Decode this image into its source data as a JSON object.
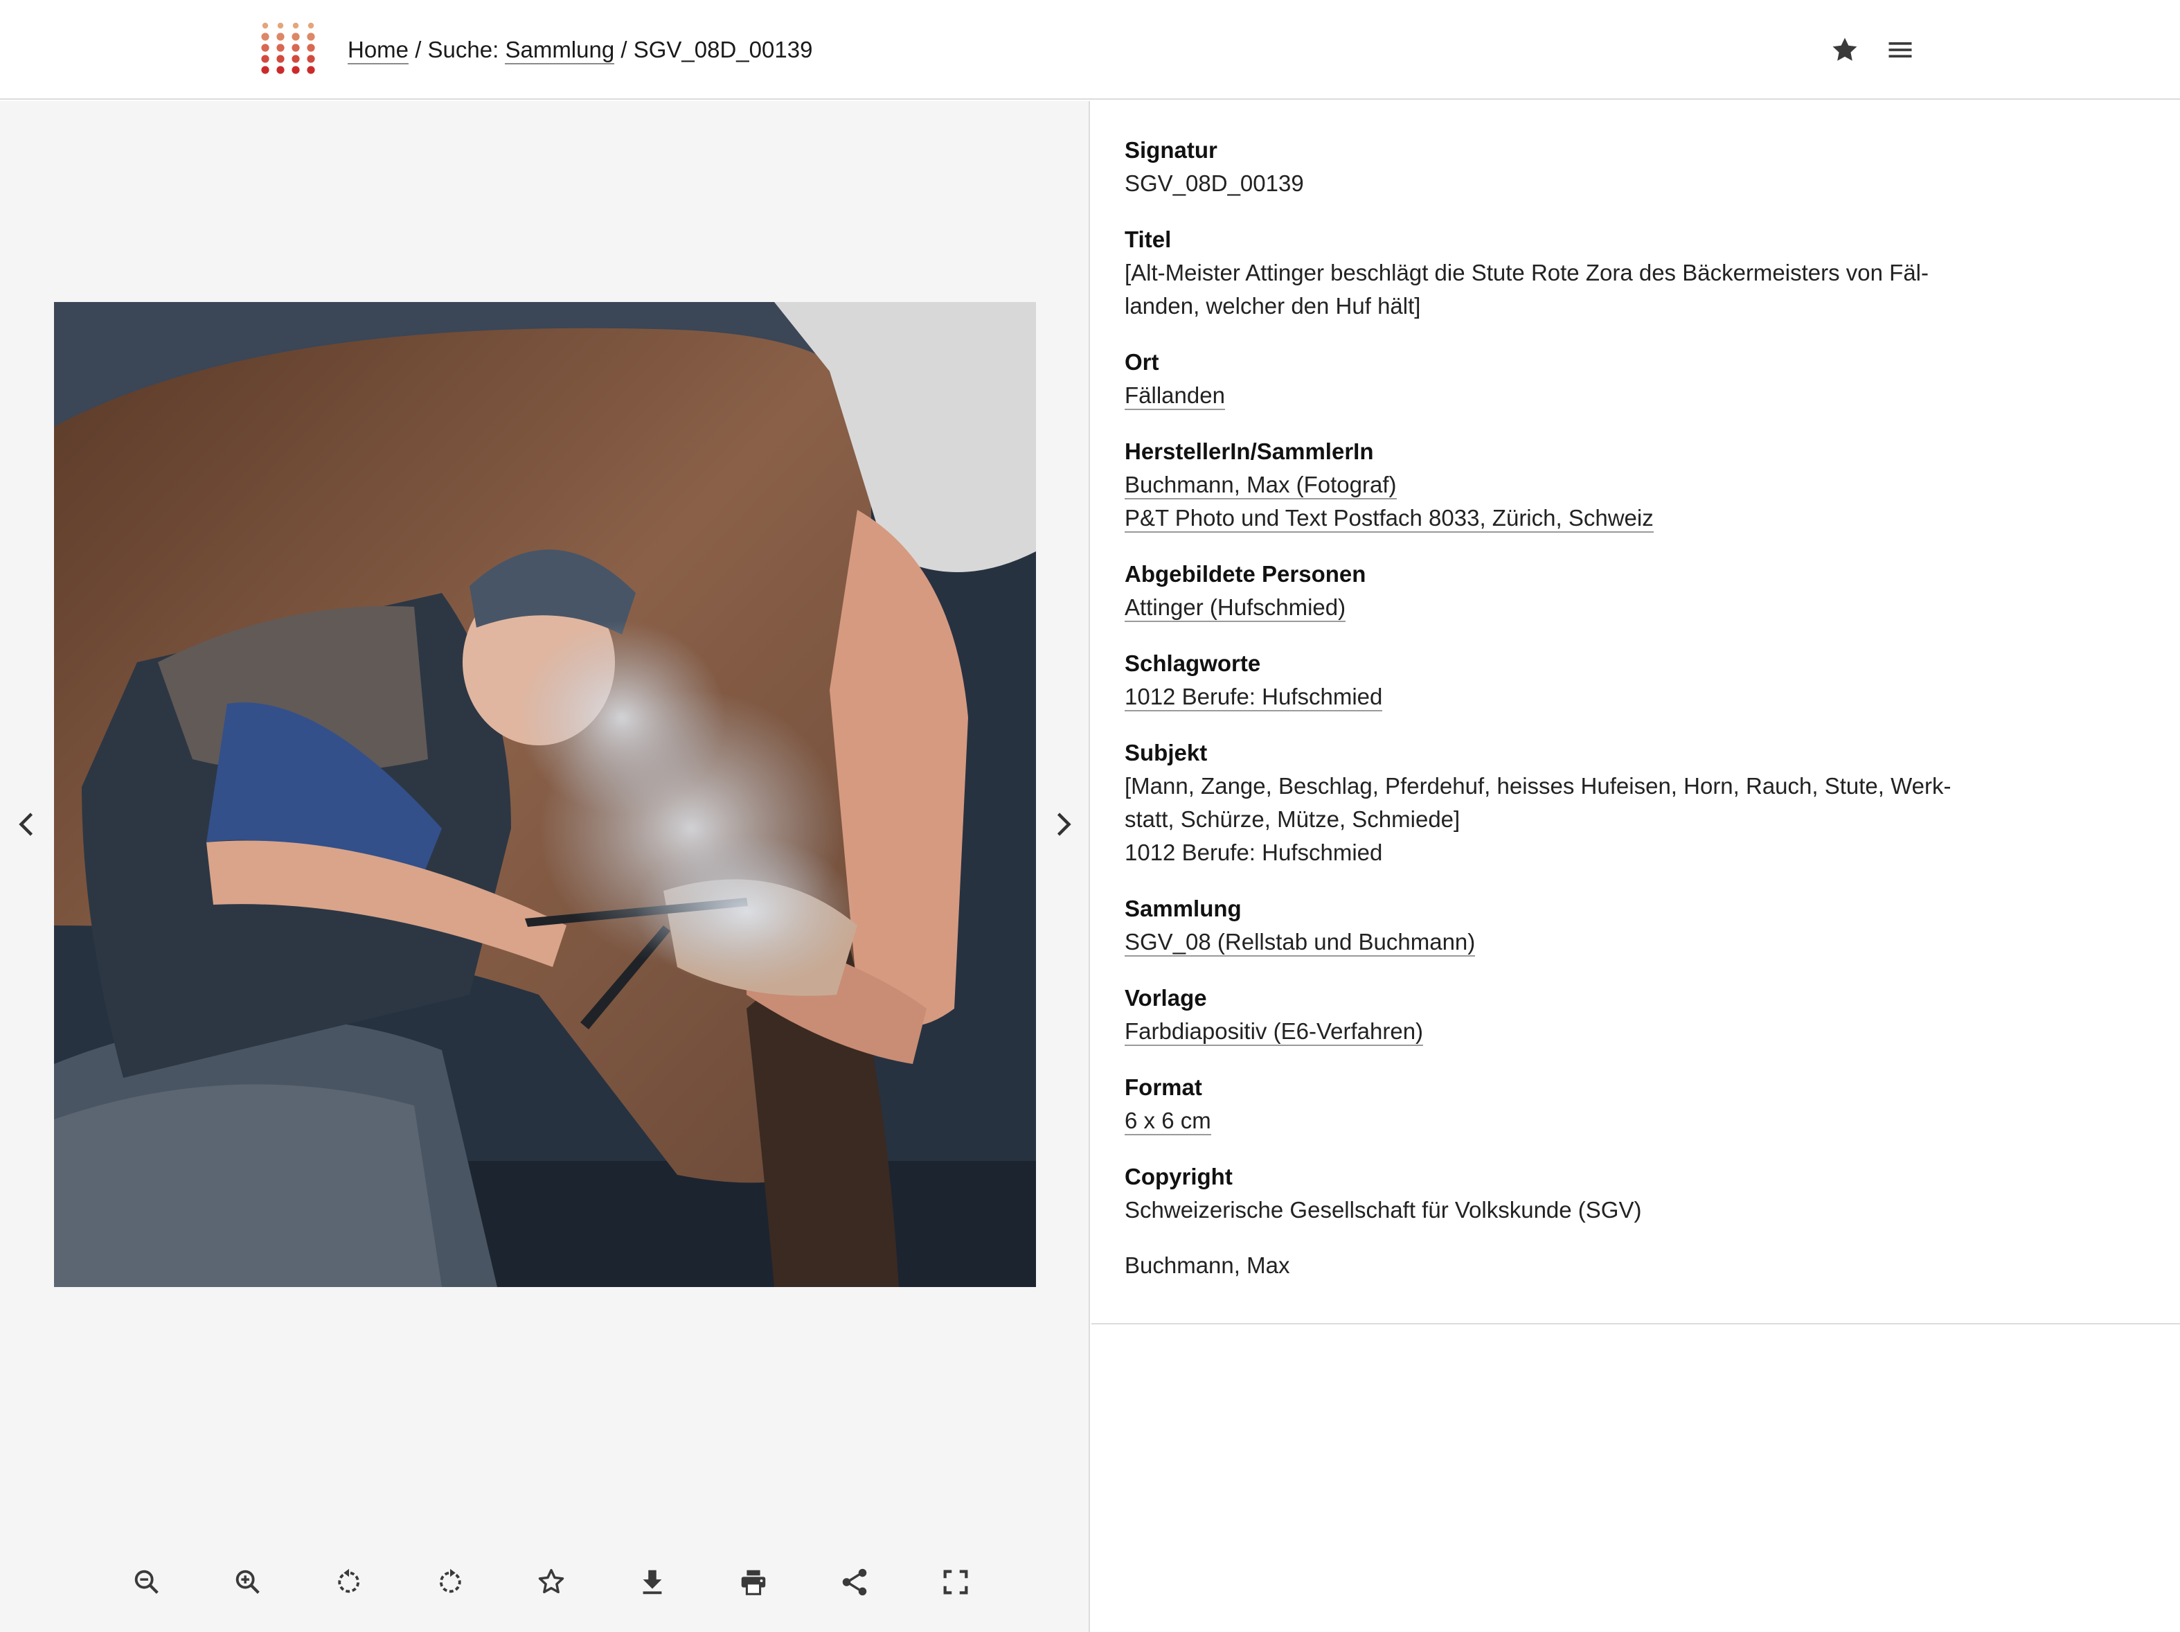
{
  "header": {
    "breadcrumb": {
      "home": "Home",
      "sep1": " / ",
      "search_prefix": "Suche: ",
      "search_link": "Sammlung",
      "sep2": " / ",
      "current": "SGV_08D_00139"
    },
    "icons": [
      "logo-dots",
      "star-icon",
      "menu-icon"
    ]
  },
  "colors": {
    "logo_top": "#e3a67a",
    "logo_bottom": "#cc2a2a",
    "viewer_bg": "#f5f5f6",
    "text": "#1a1a1a"
  },
  "viewer": {
    "prev_icon": "chevron-left-icon",
    "next_icon": "chevron-right-icon",
    "toolbar": [
      {
        "name": "zoom-out",
        "icon": "zoom-out-icon"
      },
      {
        "name": "zoom-in",
        "icon": "zoom-in-icon"
      },
      {
        "name": "rotate-left",
        "icon": "rotate-left-icon"
      },
      {
        "name": "rotate-right",
        "icon": "rotate-right-icon"
      },
      {
        "name": "favorite",
        "icon": "star-outline-icon"
      },
      {
        "name": "download",
        "icon": "download-icon"
      },
      {
        "name": "print",
        "icon": "print-icon"
      },
      {
        "name": "share",
        "icon": "share-icon"
      },
      {
        "name": "fullscreen",
        "icon": "fullscreen-icon"
      }
    ]
  },
  "metadata": {
    "signatur": {
      "label": "Signatur",
      "value": "SGV_08D_00139"
    },
    "titel": {
      "label": "Titel",
      "line1": "[Alt-Meister Attinger beschlägt die Stute Rote Zora des Bäckermeisters von Fäl-",
      "line2": "landen, welcher den Huf hält]"
    },
    "ort": {
      "label": "Ort",
      "value": "Fällanden"
    },
    "hersteller": {
      "label": "HerstellerIn/SammlerIn",
      "value1": "Buchmann, Max (Fotograf)",
      "value2": "P&T Photo und Text Postfach 8033, Zürich, Schweiz"
    },
    "personen": {
      "label": "Abgebildete Personen",
      "value": "Attinger (Hufschmied)"
    },
    "schlagworte": {
      "label": "Schlagworte",
      "value": "1012 Berufe: Hufschmied"
    },
    "subjekt": {
      "label": "Subjekt",
      "line1": "[Mann, Zange, Beschlag, Pferdehuf, heisses Hufeisen, Horn, Rauch, Stute, Werk-",
      "line2": "statt, Schürze, Mütze, Schmiede]",
      "line3": "1012 Berufe: Hufschmied"
    },
    "sammlung": {
      "label": "Sammlung",
      "value": "SGV_08 (Rellstab und Buchmann)"
    },
    "vorlage": {
      "label": "Vorlage",
      "value": "Farbdiapositiv (E6-Verfahren)"
    },
    "format": {
      "label": "Format",
      "value": "6 x 6 cm"
    },
    "copyright": {
      "label": "Copyright",
      "value": "Schweizerische Gesellschaft für Volkskunde (SGV)"
    },
    "credit": "Buchmann, Max"
  }
}
